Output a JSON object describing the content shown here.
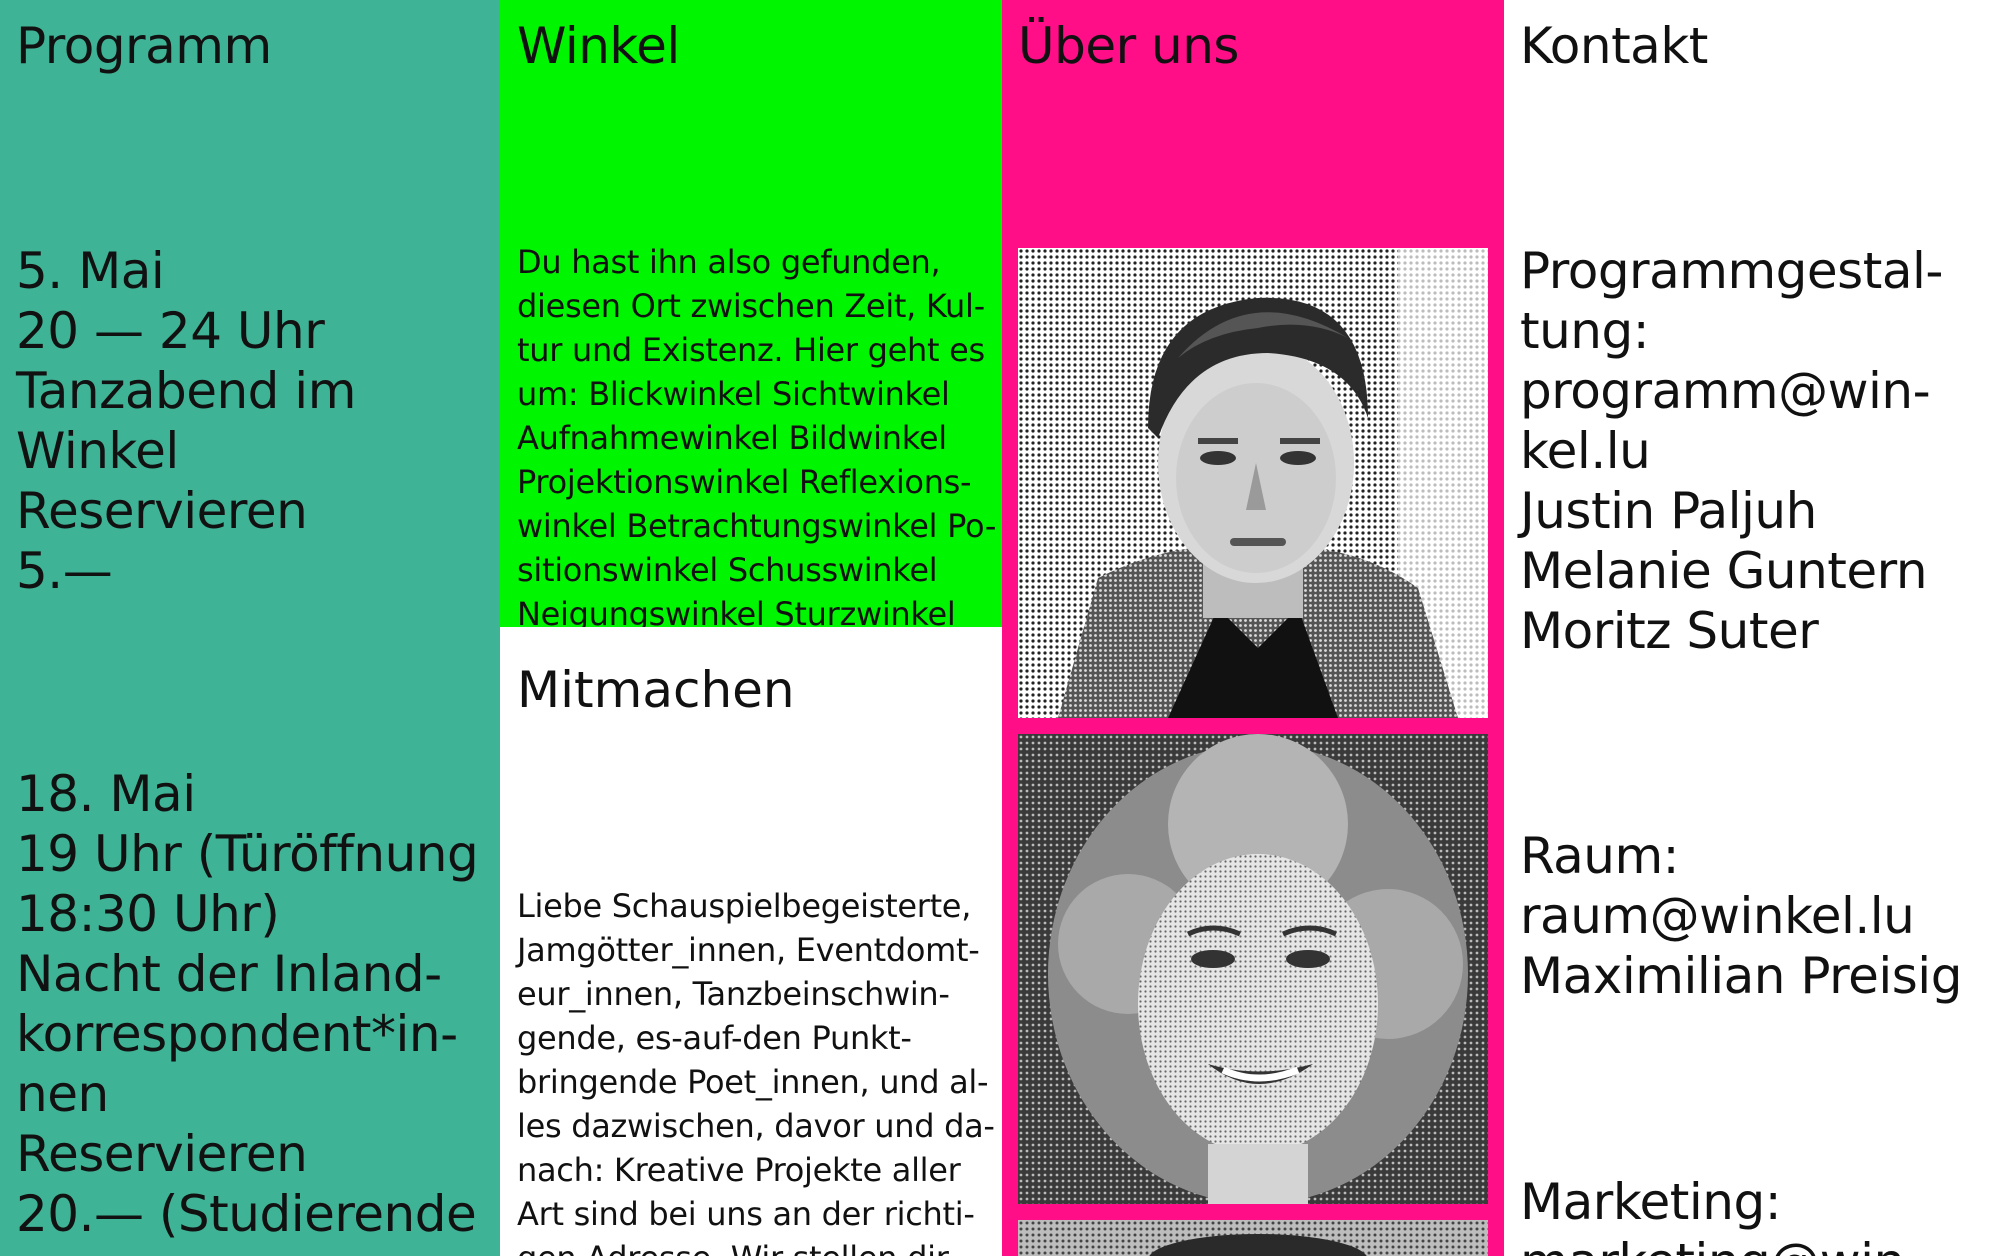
{
  "nav": {
    "programm": "Programm",
    "winkel": "Winkel",
    "ueber_uns": "Über uns",
    "kontakt": "Kontakt"
  },
  "colors": {
    "programm_bg": "#3fb396",
    "winkel_bg": "#00f500",
    "ueber_bg": "#ff0e87",
    "kontakt_bg": "#ffffff"
  },
  "programm": {
    "events": [
      {
        "date": "5. Mai",
        "time": "20 — 24 Uhr",
        "title_lines": [
          "Tanzabend im",
          "Winkel"
        ],
        "reserve": "Reservieren",
        "price": "5.—"
      },
      {
        "date": "18. Mai",
        "time_lines": [
          "19 Uhr (Türöffnung",
          "18:30 Uhr)"
        ],
        "title_lines": [
          "Nacht der Inland-",
          "korrespondent*in-",
          "nen"
        ],
        "reserve": "Reservieren",
        "price": "20.— (Studierende"
      }
    ]
  },
  "winkel": {
    "text_lines": [
      "Du hast ihn also gefunden,",
      "diesen Ort zwischen Zeit, Kul-",
      "tur und Existenz. Hier geht es",
      "um: Blickwinkel Sichtwinkel",
      "Aufnahmewinkel Bildwinkel",
      "Projektionswinkel Reflexions-",
      "winkel Betrachtungswinkel Po-",
      "sitionswinkel Schusswinkel",
      "Neigungswinkel Sturzwinkel"
    ],
    "mitmachen_title": "Mitmachen",
    "mitmachen_lines": [
      "Liebe Schauspielbegeisterte,",
      "Jamgötter_innen,  Eventdomt-",
      "eur_innen, Tanzbeinschwin-",
      "gende, es-auf-den Punkt-",
      "bringende Poet_innen, und al-",
      "les dazwischen, davor und da-",
      "nach: Kreative Projekte aller",
      "Art sind bei uns an der richti-",
      "gen Adresse. Wir stellen dir"
    ]
  },
  "ueber_uns": {
    "photos": [
      "portrait-man",
      "portrait-woman",
      "portrait-third"
    ]
  },
  "kontakt": {
    "programm_lines": [
      "Programmgestal-",
      "tung:",
      "programm@win-",
      "kel.lu",
      "Justin Paljuh",
      "Melanie Guntern",
      "Moritz Suter"
    ],
    "raum_lines": [
      "Raum:",
      "raum@winkel.lu",
      "Maximilian Preisig"
    ],
    "marketing_lines": [
      "Marketing:",
      "marketing@win-"
    ]
  }
}
